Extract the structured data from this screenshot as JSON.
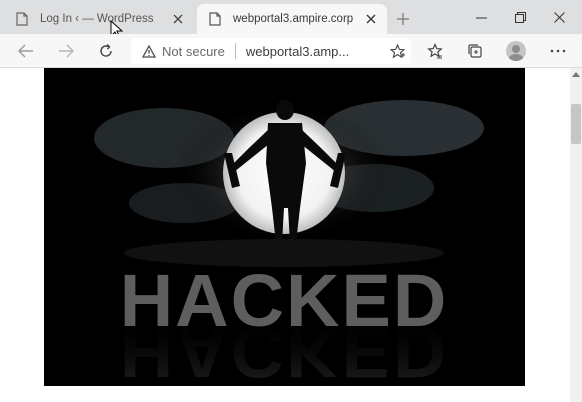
{
  "tabs": [
    {
      "title": "Log In ‹ — WordPress",
      "active": false
    },
    {
      "title": "webportal3.ampire.corp",
      "active": true
    }
  ],
  "toolbar": {
    "security_label": "Not secure",
    "url": "webportal3.amp..."
  },
  "page": {
    "banner_text": "HACKED"
  },
  "colors": {
    "tabstrip_bg": "#dedfe1",
    "toolbar_bg": "#f7f7f7",
    "banner_text": "#5e5e5e"
  },
  "icons": [
    "page-icon",
    "close-icon",
    "new-tab-icon",
    "minimize-icon",
    "maximize-icon",
    "back-icon",
    "forward-icon",
    "refresh-icon",
    "warning-icon",
    "favorites-star-icon",
    "favorites-icon",
    "collections-icon",
    "profile-icon",
    "more-icon"
  ]
}
